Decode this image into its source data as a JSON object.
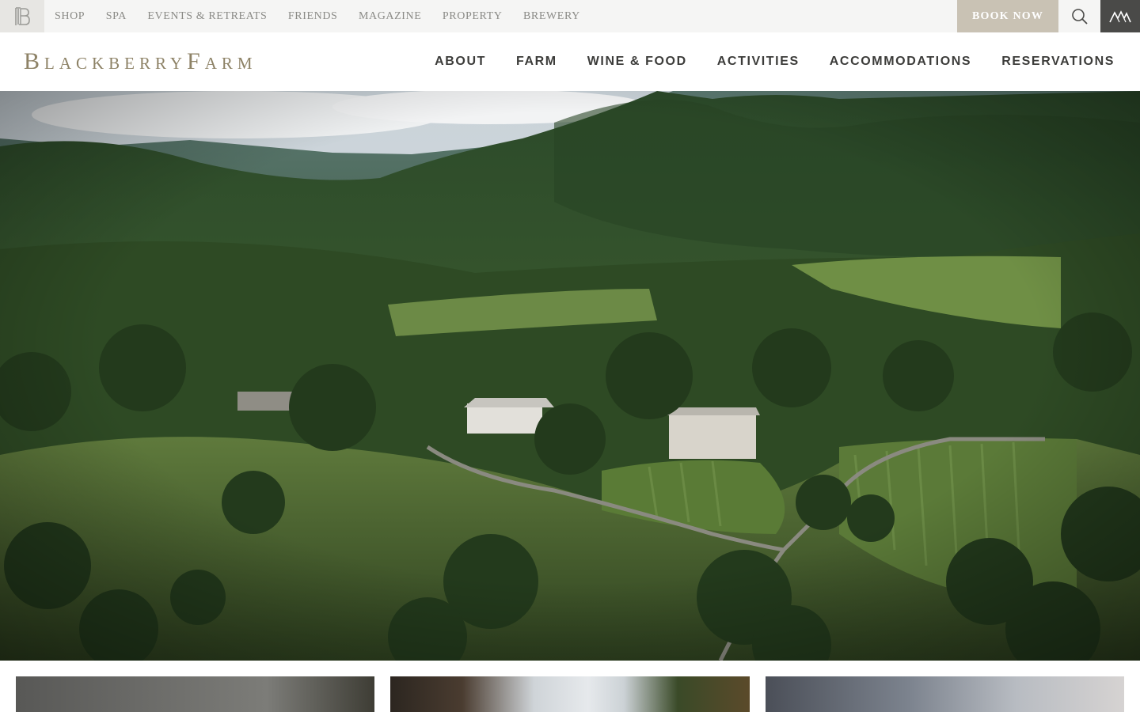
{
  "utility_nav": {
    "monogram": "BF",
    "items": [
      "SHOP",
      "SPA",
      "EVENTS & RETREATS",
      "FRIENDS",
      "MAGAZINE",
      "PROPERTY",
      "BREWERY"
    ],
    "book_now": "BOOK NOW"
  },
  "header": {
    "brand": "BlackberryFarm",
    "nav": [
      "ABOUT",
      "FARM",
      "WINE & FOOD",
      "ACTIVITIES",
      "ACCOMMODATIONS",
      "RESERVATIONS"
    ]
  },
  "icons": {
    "search": "search-icon",
    "mountain": "mountain-logo-icon"
  },
  "colors": {
    "utility_bg": "#f5f5f4",
    "book_now_bg": "#c9c2b4",
    "brand": "#8d8266",
    "nav_text": "#3c3c3a",
    "dark_button": "#4a4a48"
  }
}
